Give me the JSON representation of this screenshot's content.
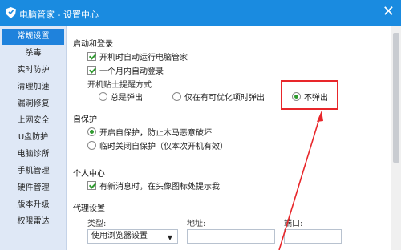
{
  "window": {
    "title": "电脑管家 - 设置中心",
    "close_glyph": "✕",
    "logo_icon": "shield-logo-icon"
  },
  "sidebar": {
    "items": [
      {
        "label": "常规设置",
        "active": true
      },
      {
        "label": "杀毒"
      },
      {
        "label": "实时防护"
      },
      {
        "label": "清理加速"
      },
      {
        "label": "漏洞修复"
      },
      {
        "label": "上网安全"
      },
      {
        "label": "U盘防护"
      },
      {
        "label": "电脑诊所"
      },
      {
        "label": "手机管理"
      },
      {
        "label": "硬件管理"
      },
      {
        "label": "版本升级"
      },
      {
        "label": "权限雷达"
      }
    ]
  },
  "startup": {
    "title": "启动和登录",
    "auto_run": {
      "label": "开机时自动运行电脑管家",
      "checked": true
    },
    "auto_login": {
      "label": "一个月内自动登录",
      "checked": true
    },
    "popup_label": "开机贴士提醒方式",
    "popup_options": [
      {
        "label": "总是弹出",
        "selected": false
      },
      {
        "label": "仅在有可优化项时弹出",
        "selected": false
      },
      {
        "label": "不弹出",
        "selected": true
      }
    ]
  },
  "self_protect": {
    "title": "自保护",
    "options": [
      {
        "label": "开启自保护，防止木马恶意破坏",
        "selected": true
      },
      {
        "label": "临时关闭自保护（仅本次开机有效）",
        "selected": false
      }
    ]
  },
  "personal": {
    "title": "个人中心",
    "new_message": {
      "label": "有新消息时，在头像图标处提示我",
      "checked": true
    }
  },
  "proxy": {
    "title": "代理设置",
    "type_label": "类型:",
    "type_value": "使用浏览器设置",
    "address_label": "地址:",
    "port_label": "端口:"
  },
  "colors": {
    "titlebar": "#1a8be0",
    "sidebar_active": "#1f82dc",
    "annotation": "#e8262a",
    "check": "#2e9a2e"
  }
}
